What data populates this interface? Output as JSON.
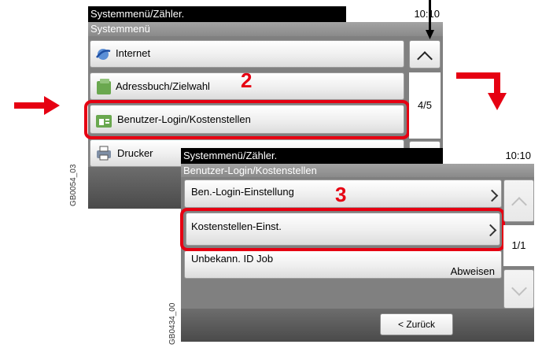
{
  "panel1": {
    "title": "Systemmenü/Zähler.",
    "time": "10:10",
    "subtitle": "Systemmenü",
    "items": [
      {
        "label": "Internet",
        "icon": "internet-icon"
      },
      {
        "label": "Adressbuch/Zielwahl",
        "icon": "address-book-icon"
      },
      {
        "label": "Benutzer-Login/Kostenstellen",
        "icon": "user-login-icon"
      },
      {
        "label": "Drucker",
        "icon": "printer-icon"
      }
    ],
    "page_indicator": "4/5",
    "image_code": "GB0054_03"
  },
  "panel2": {
    "title": "Systemmenü/Zähler.",
    "time": "10:10",
    "subtitle": "Benutzer-Login/Kostenstellen",
    "items": [
      {
        "label": "Ben.-Login-Einstellung"
      },
      {
        "label": "Kostenstellen-Einst."
      },
      {
        "label": "Unbekann. ID Job",
        "value": "Abweisen"
      }
    ],
    "page_indicator": "1/1",
    "back_label": "< Zurück",
    "image_code": "GB0434_00"
  },
  "steps": {
    "step2": "2",
    "step3": "3"
  },
  "colors": {
    "highlight": "#e60012",
    "titlebar": "#000000",
    "bottombar": "#555555"
  }
}
